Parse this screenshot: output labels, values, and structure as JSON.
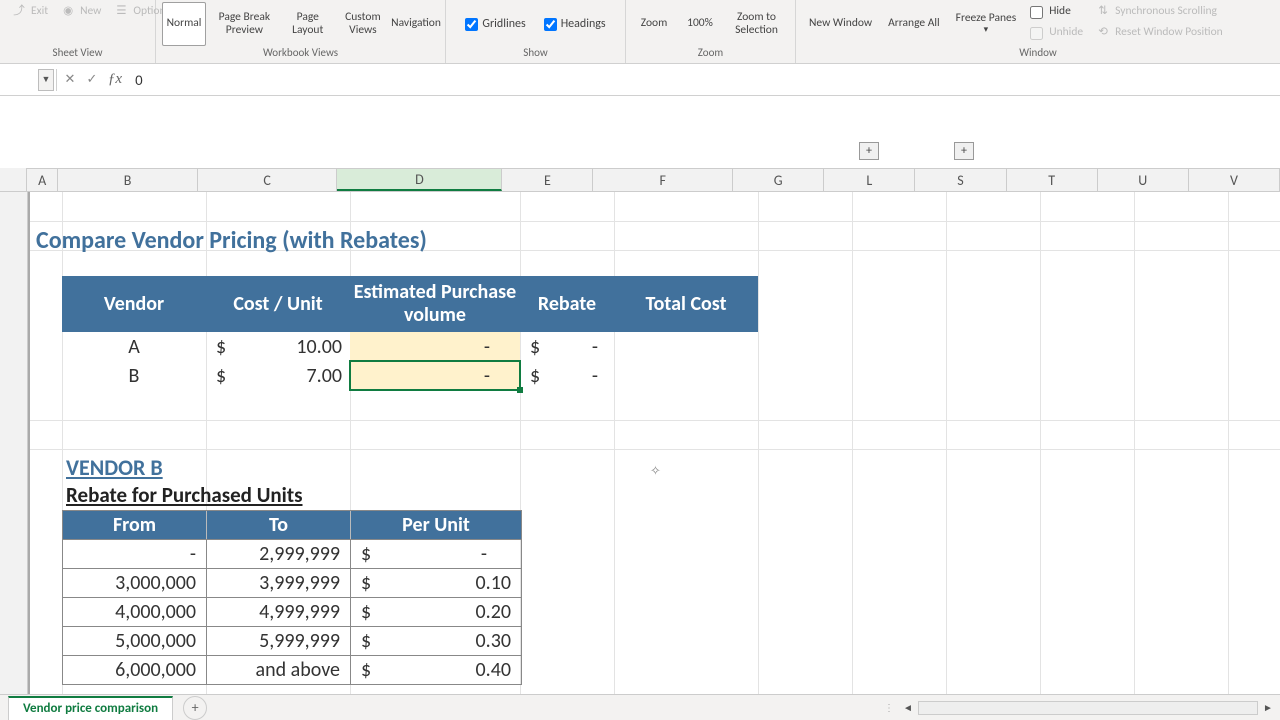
{
  "ribbon": {
    "sheet_view": {
      "label": "Sheet View",
      "exit": "Exit",
      "new": "New",
      "options": "Options"
    },
    "workbook_views": {
      "label": "Workbook Views",
      "normal": "Normal",
      "page_break": "Page Break Preview",
      "page_layout": "Page Layout",
      "custom": "Custom Views",
      "navigation": "Navigation"
    },
    "show": {
      "label": "Show",
      "gridlines": "Gridlines",
      "headings": "Headings"
    },
    "zoom": {
      "label": "Zoom",
      "zoom": "Zoom",
      "full": "100%",
      "zoom_sel": "Zoom to Selection"
    },
    "window": {
      "label": "Window",
      "new_window": "New Window",
      "arrange": "Arrange All",
      "freeze": "Freeze Panes",
      "hide": "Hide",
      "unhide": "Unhide",
      "sync": "Synchronous Scrolling",
      "reset": "Reset Window Position"
    }
  },
  "formula_bar": {
    "value": "0"
  },
  "columns": [
    "A",
    "B",
    "C",
    "D",
    "E",
    "F",
    "G",
    "L",
    "S",
    "T",
    "U",
    "V"
  ],
  "title": "Compare Vendor Pricing (with Rebates)",
  "table_headers": {
    "vendor": "Vendor",
    "cost": "Cost / Unit",
    "volume": "Estimated Purchase volume",
    "rebate": "Rebate",
    "total": "Total Cost"
  },
  "rows": [
    {
      "vendor": "A",
      "cost": "10.00",
      "volume": "-",
      "rebate": "-",
      "total": ""
    },
    {
      "vendor": "B",
      "cost": "7.00",
      "volume": "-",
      "rebate": "-",
      "total": ""
    }
  ],
  "vendor_b": {
    "title": "VENDOR B",
    "subtitle": "Rebate for Purchased Units"
  },
  "rebate_headers": {
    "from": "From",
    "to": "To",
    "per_unit": "Per Unit"
  },
  "rebate_rows": [
    {
      "from": "-",
      "to": "2,999,999",
      "per_unit": "-"
    },
    {
      "from": "3,000,000",
      "to": "3,999,999",
      "per_unit": "0.10"
    },
    {
      "from": "4,000,000",
      "to": "4,999,999",
      "per_unit": "0.20"
    },
    {
      "from": "5,000,000",
      "to": "5,999,999",
      "per_unit": "0.30"
    },
    {
      "from": "6,000,000",
      "to": "and above",
      "per_unit": "0.40"
    }
  ],
  "sheet_tab": "Vendor price comparison",
  "expand_plus": "+",
  "chart_data": {
    "type": "table",
    "title": "Compare Vendor Pricing (with Rebates)",
    "comparison": {
      "columns": [
        "Vendor",
        "Cost / Unit",
        "Estimated Purchase volume",
        "Rebate",
        "Total Cost"
      ],
      "rows": [
        [
          "A",
          10.0,
          0,
          0,
          null
        ],
        [
          "B",
          7.0,
          0,
          0,
          null
        ]
      ]
    },
    "vendor_b_rebates": {
      "columns": [
        "From",
        "To",
        "Per Unit"
      ],
      "rows": [
        [
          0,
          2999999,
          0
        ],
        [
          3000000,
          3999999,
          0.1
        ],
        [
          4000000,
          4999999,
          0.2
        ],
        [
          5000000,
          5999999,
          0.3
        ],
        [
          6000000,
          null,
          0.4
        ]
      ]
    }
  }
}
